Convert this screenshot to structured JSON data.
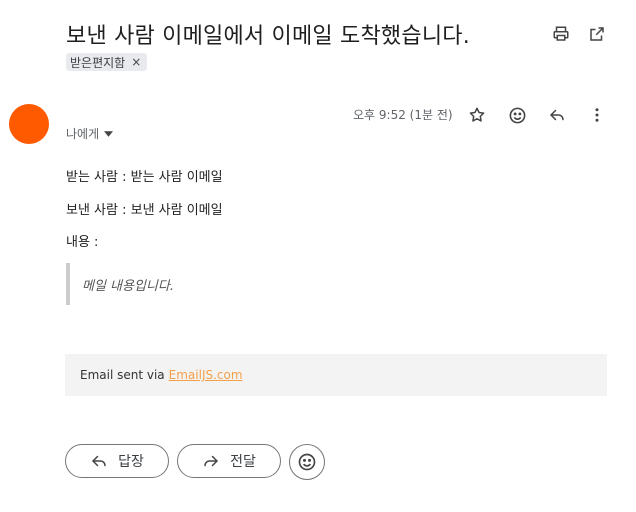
{
  "subject": "보낸 사람 이메일에서 이메일 도착했습니다.",
  "label_chip": {
    "text": "받은편지함",
    "remove": "×"
  },
  "header_icons": [
    "printer-icon",
    "open-in-new-icon"
  ],
  "sender": {
    "name": "",
    "avatar_color": "#ff5a00",
    "recipient": "나에게",
    "time": "오후 9:52 (1분 전)"
  },
  "message_actions": [
    "star-icon",
    "emoji-icon",
    "reply-icon",
    "more-vert-icon"
  ],
  "body": {
    "line_to": "받는 사람 : 받는 사람 이메일",
    "line_from": "보낸 사람 : 보낸 사람 이메일",
    "line_content": "내용 :",
    "quote": "메일 내용입니다."
  },
  "footer": {
    "text": "Email sent via",
    "link": "EmailJS.com",
    "link_color": "#f4a04a"
  },
  "reply_buttons": {
    "reply": "답장",
    "forward": "전달"
  }
}
